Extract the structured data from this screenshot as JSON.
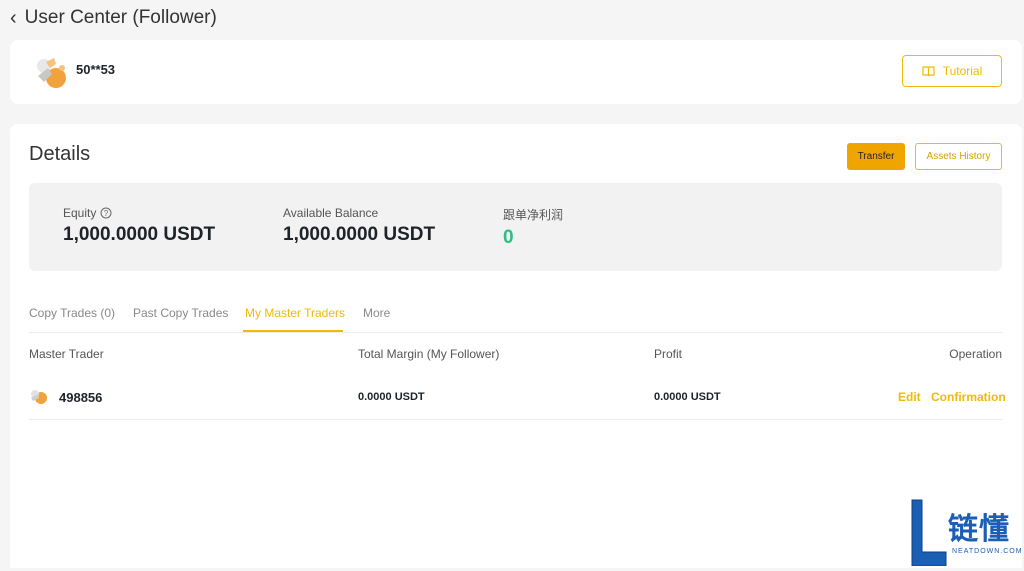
{
  "header": {
    "title": "User Center (Follower)"
  },
  "profile": {
    "username": "50**53",
    "tutorial_label": "Tutorial"
  },
  "details": {
    "title": "Details",
    "transfer_label": "Transfer",
    "assets_history_label": "Assets History",
    "stats": {
      "equity": {
        "label": "Equity",
        "value": "1,000.0000 USDT"
      },
      "available": {
        "label": "Available Balance",
        "value": "1,000.0000 USDT"
      },
      "net_profit": {
        "label": "跟单净利润",
        "value": "0"
      }
    }
  },
  "tabs": [
    {
      "label": "Copy Trades (0)"
    },
    {
      "label": "Past Copy Trades"
    },
    {
      "label": "My Master Traders"
    },
    {
      "label": "More"
    }
  ],
  "active_tab_index": 2,
  "table": {
    "headers": [
      "Master Trader",
      "Total Margin (My Follower)",
      "Profit",
      "Operation"
    ],
    "rows": [
      {
        "trader": "498856",
        "total_margin": "0.0000 USDT",
        "profit": "0.0000 USDT",
        "edit": "Edit",
        "confirm": "Confirmation"
      }
    ]
  },
  "watermark": {
    "cn": "链懂",
    "en": "NEATDOWN.COM"
  },
  "colors": {
    "accent": "#f0b90b",
    "transfer_bg": "#f0a400",
    "profit_green": "#2ebd85",
    "watermark_blue": "#1a5fb4"
  }
}
